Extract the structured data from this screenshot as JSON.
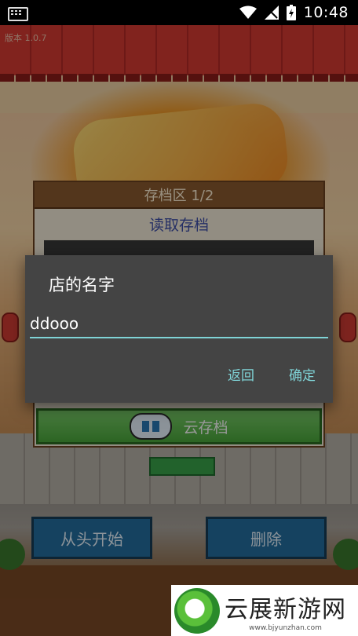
{
  "status_bar": {
    "time": "10:48"
  },
  "game": {
    "version": "版本 1.0.7",
    "panel_title": "存档区 1/2",
    "panel_subtitle": "读取存档",
    "cloud_save_label": "云存档",
    "restart_label": "从头开始",
    "delete_label": "删除"
  },
  "dialog": {
    "title": "店的名字",
    "input_value": "ddooo",
    "back_label": "返回",
    "confirm_label": "确定",
    "accent_color": "#7fd3d6"
  },
  "watermark": {
    "brand": "云展新游网",
    "url": "www.bjyunzhan.com"
  }
}
